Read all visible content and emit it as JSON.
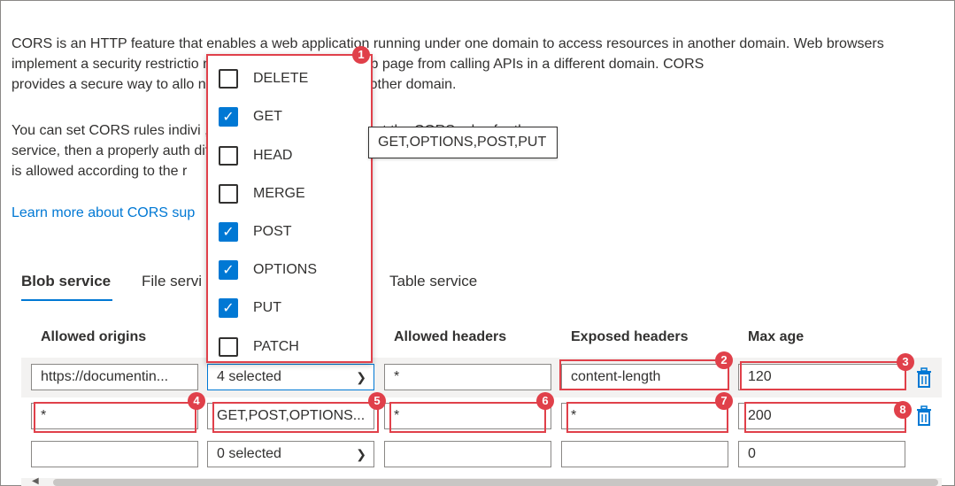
{
  "description": {
    "paragraph1": "CORS is an HTTP feature that enables a web application running under one domain to access resources in another domain. Web browsers\nimplement a security restrictio                              n policy that prevents a web page from calling APIs in a different domain. CORS\nprovides a secure way to allo                              n domain) to call APIs in another domain.",
    "paragraph2": "You can set CORS rules indivi                                                                 , queue, table). Once you set the CORS rules for the\nservice, then a properly auth                                                                  different domain will be evaluated to determine whether it\nis allowed according to the r",
    "learn_more": "Learn more about CORS sup"
  },
  "tabs": [
    "Blob service",
    "File servi",
    "Table service"
  ],
  "columns": {
    "allowed_origins": "Allowed origins",
    "allowed_headers": "Allowed headers",
    "exposed_headers": "Exposed headers",
    "max_age": "Max age"
  },
  "rows": [
    {
      "origins": "https://documentin...",
      "methods": "4 selected",
      "allowed_headers": "*",
      "exposed_headers": "content-length",
      "max_age": "120"
    },
    {
      "origins": "*",
      "methods": "GET,POST,OPTIONS...",
      "allowed_headers": "*",
      "exposed_headers": "*",
      "max_age": "200"
    },
    {
      "origins": "",
      "methods": "0 selected",
      "allowed_headers": "",
      "exposed_headers": "",
      "max_age": "0"
    }
  ],
  "methods_dropdown": {
    "options": [
      {
        "label": "DELETE",
        "checked": false
      },
      {
        "label": "GET",
        "checked": true
      },
      {
        "label": "HEAD",
        "checked": false
      },
      {
        "label": "MERGE",
        "checked": false
      },
      {
        "label": "POST",
        "checked": true
      },
      {
        "label": "OPTIONS",
        "checked": true
      },
      {
        "label": "PUT",
        "checked": true
      },
      {
        "label": "PATCH",
        "checked": false
      }
    ]
  },
  "tooltip": "GET,OPTIONS,POST,PUT",
  "callouts": [
    "1",
    "2",
    "3",
    "4",
    "5",
    "6",
    "7",
    "8"
  ],
  "icons": {
    "delete": "trash-icon",
    "check": "check-icon",
    "chevron": "chevron-down-icon"
  },
  "colors": {
    "accent": "#0078d4",
    "callout": "#e0404a"
  }
}
